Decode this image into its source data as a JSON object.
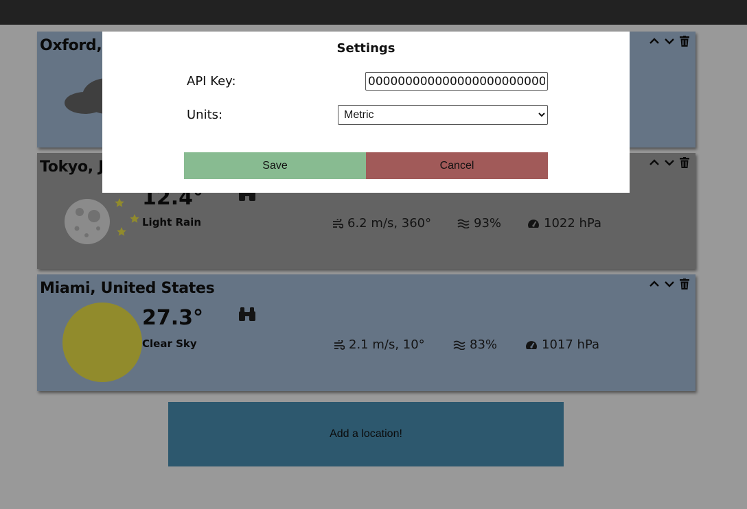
{
  "locations": [
    {
      "city": "Oxford, United Kingdom",
      "icon": "cloud-icon",
      "background": "#a9c1de"
    },
    {
      "city": "Tokyo, Japan",
      "temperature": "12.4°",
      "description": "Light Rain",
      "wind": "6.2 m/s, 360°",
      "humidity": "93%",
      "pressure": "1022 hPa",
      "icon": "moon-icon",
      "background": "#a6a6a6"
    },
    {
      "city": "Miami, United States",
      "temperature": "27.3°",
      "description": "Clear Sky",
      "wind": "2.1 m/s, 10°",
      "humidity": "83%",
      "pressure": "1017 hPa",
      "icon": "sun-icon",
      "background": "#a9c1de"
    }
  ],
  "add_location_label": "Add a location!",
  "settings": {
    "title": "Settings",
    "api_key_label": "API Key:",
    "api_key_value": "0000000000000000000000000000",
    "units_label": "Units:",
    "units_selected": "Metric",
    "save_label": "Save",
    "cancel_label": "Cancel"
  },
  "colors": {
    "save": "#88bb91",
    "cancel": "#a15a59",
    "add_button": "#4c93b8",
    "sun": "#f2e84a",
    "moon": "#e8e8e8"
  }
}
